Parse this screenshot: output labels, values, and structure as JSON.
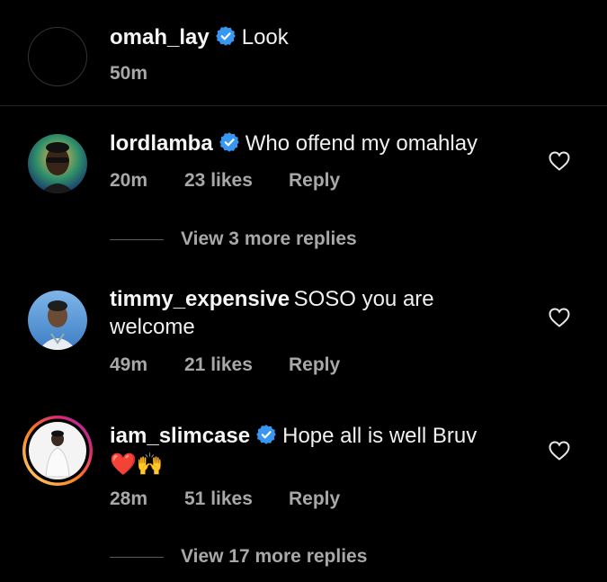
{
  "caption": {
    "username": "omah_lay",
    "verified": true,
    "text": "Look",
    "time": "50m"
  },
  "comments": [
    {
      "username": "lordlamba",
      "verified": true,
      "text": "Who offend my omahlay",
      "time": "20m",
      "likes": "23 likes",
      "reply": "Reply",
      "view_replies": "View 3 more replies"
    },
    {
      "username": "timmy_expensive",
      "verified": false,
      "text_line1": "SOSO you are",
      "text_line2": "welcome",
      "time": "49m",
      "likes": "21 likes",
      "reply": "Reply"
    },
    {
      "username": "iam_slimcase",
      "verified": true,
      "text_line1": "Hope all is well Bruv",
      "emojis": "❤️🙌",
      "time": "28m",
      "likes": "51 likes",
      "reply": "Reply",
      "view_replies": "View 17 more replies"
    }
  ],
  "colors": {
    "background": "#000000",
    "verified_blue": "#3897f0",
    "meta_gray": "#a8a8a8",
    "story_ring_start": "#feda75",
    "story_ring_end": "#d62976"
  }
}
